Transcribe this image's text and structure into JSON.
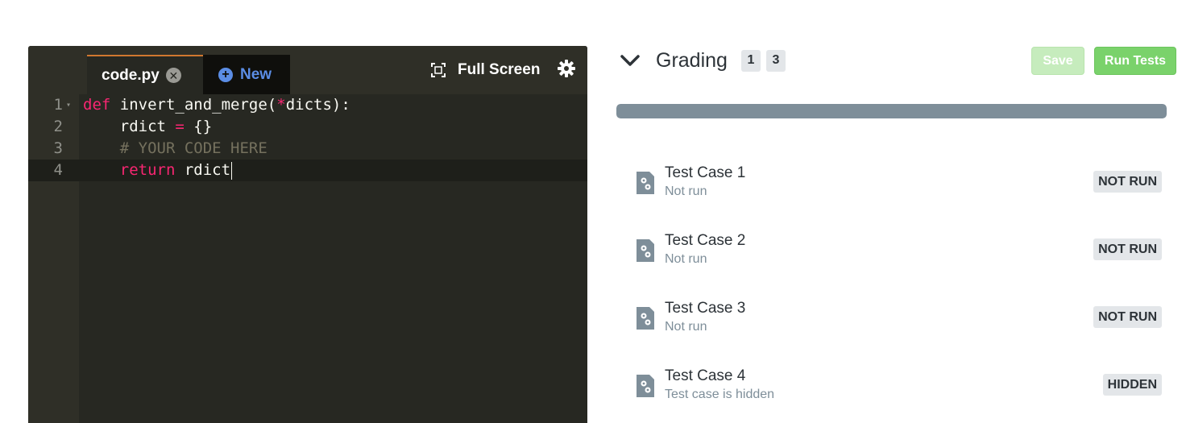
{
  "editor": {
    "tabs": [
      {
        "label": "code.py",
        "close_glyph": "✕"
      },
      {
        "label": "New",
        "icon": "plus-circle-icon"
      }
    ],
    "full_screen_label": "Full Screen",
    "lines": [
      {
        "number": "1"
      },
      {
        "number": "2"
      },
      {
        "number": "3"
      },
      {
        "number": "4"
      }
    ],
    "code": {
      "line1": {
        "kw": "def",
        "rest_a": " invert_and_merge(",
        "star": "*",
        "rest_b": "dicts):"
      },
      "line2": {
        "a": "    rdict ",
        "eq": "=",
        "b": " {}"
      },
      "line3": {
        "comment": "    # YOUR CODE HERE"
      },
      "line4": {
        "indent": "    ",
        "kw": "return",
        "rest": " rdict"
      }
    }
  },
  "grading": {
    "title": "Grading",
    "counters": [
      "1",
      "3"
    ],
    "save_label": "Save",
    "run_label": "Run Tests",
    "progress": 1.0,
    "tests": [
      {
        "title": "Test Case 1",
        "subtitle": "Not run",
        "status": "NOT RUN"
      },
      {
        "title": "Test Case 2",
        "subtitle": "Not run",
        "status": "NOT RUN"
      },
      {
        "title": "Test Case 3",
        "subtitle": "Not run",
        "status": "NOT RUN"
      },
      {
        "title": "Test Case 4",
        "subtitle": "Test case is hidden",
        "status": "HIDDEN"
      }
    ]
  },
  "colors": {
    "editor_bg": "#272822",
    "accent_tab": "#d0782f",
    "keyword": "#f92672",
    "comment": "#75715e",
    "new_tab": "#5b8de5",
    "run_button": "#7ad26b",
    "save_button_disabled": "#c6ecbd",
    "progress_fill": "#7e8e99"
  }
}
